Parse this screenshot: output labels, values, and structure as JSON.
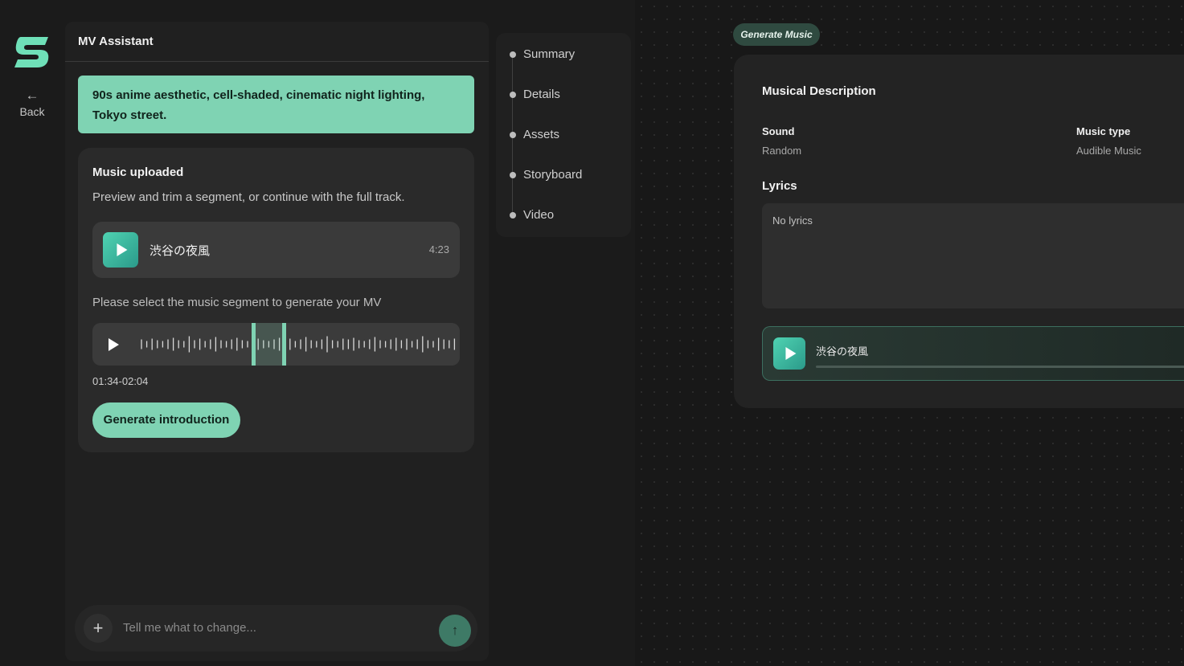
{
  "nav": {
    "back_label": "Back"
  },
  "assistant": {
    "title": "MV Assistant",
    "prompt": "90s anime aesthetic, cell-shaded, cinematic night lighting, Tokyo street.",
    "music_card": {
      "title": "Music uploaded",
      "description": "Preview and trim a segment, or continue with the full track.",
      "track": {
        "name": "渋谷の夜風",
        "duration": "4:23"
      },
      "segment_label": "Please select the music segment to generate your MV",
      "segment_range": "01:34-02:04",
      "generate_button": "Generate introduction"
    },
    "composer": {
      "placeholder": "Tell me what to change..."
    }
  },
  "steps": [
    "Summary",
    "Details",
    "Assets",
    "Storyboard",
    "Video"
  ],
  "canvas": {
    "tag": "Generate Music",
    "card": {
      "title": "Musical Description",
      "sound_label": "Sound",
      "sound_value": "Random",
      "music_type_label": "Music type",
      "music_type_value": "Audible Music",
      "lyrics_label": "Lyrics",
      "lyrics_value": "No lyrics",
      "track_name": "渋谷の夜風"
    }
  },
  "colors": {
    "accent": "#7fd3b3",
    "accent_dark": "#3e7a66",
    "play_gradient_start": "#4fd3b2",
    "play_gradient_end": "#2b9a8a"
  }
}
